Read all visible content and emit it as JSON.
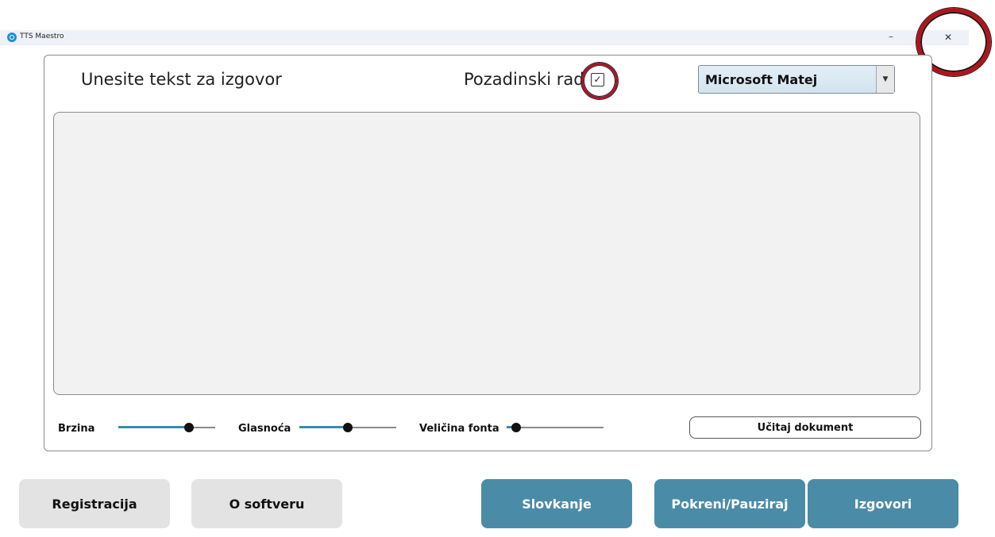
{
  "window": {
    "title": "TTS Maestro",
    "minimize_glyph": "–",
    "close_glyph": "✕"
  },
  "header": {
    "prompt": "Unesite tekst za izgovor",
    "background_label": "Pozadinski rad",
    "background_checked": true,
    "check_glyph": "✓"
  },
  "voice": {
    "selected": "Microsoft Matej",
    "arrow_glyph": "▼"
  },
  "editor": {
    "value": ""
  },
  "sliders": {
    "speed": {
      "label": "Brzina",
      "value": 0.73
    },
    "volume": {
      "label": "Glasnoća",
      "value": 0.5
    },
    "font_size": {
      "label": "Veličina fonta",
      "value": 0.1
    }
  },
  "actions": {
    "load_document": "Učitaj dokument",
    "register": "Registracija",
    "about": "O softveru",
    "spell": "Slovkanje",
    "start_pause": "Pokreni/Pauziraj",
    "speak": "Izgovori"
  },
  "colors": {
    "accent": "#4a8ca7",
    "slider_fill": "#3b8ab0",
    "annotation_ring": "#b0141b"
  },
  "icons": {
    "app": "app-logo-icon",
    "checkbox": "checkmark-icon",
    "dropdown": "chevron-down-icon"
  }
}
